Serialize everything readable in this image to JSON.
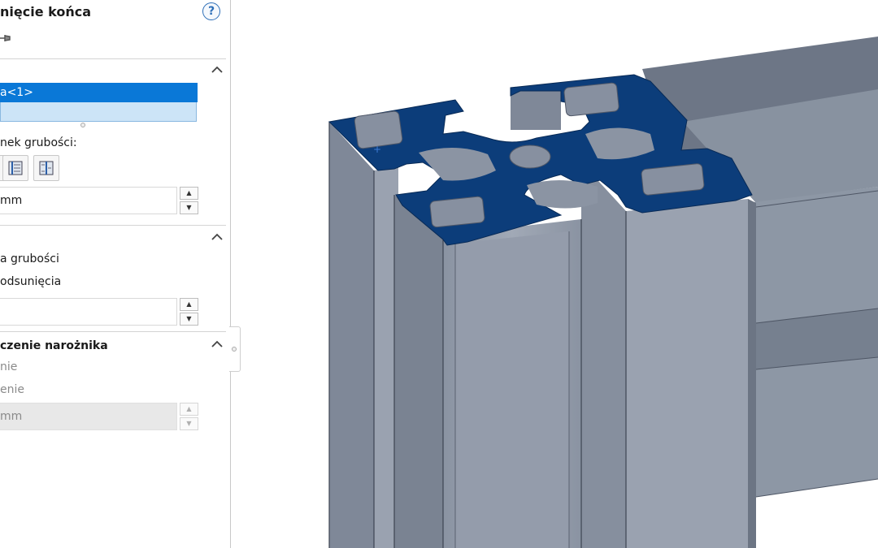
{
  "panel": {
    "title": "nięcie końca",
    "help_label": "?",
    "section_select": {
      "selected_item": "a<1>"
    },
    "section_thickness": {
      "direction_label": "nek grubości:",
      "thickness_value": "mm"
    },
    "section_offset": {
      "option1_label": "a grubości",
      "option2_label": "odsunięcia",
      "offset_value": ""
    },
    "section_corner": {
      "header": "czenie narożnika",
      "option1_label": "nie",
      "option2_label": "enie",
      "value": "mm"
    }
  },
  "viewport": {
    "colors": {
      "face_selected": "#0c3d7a",
      "metal_light": "#9aa2b0",
      "metal_mid": "#8a93a2",
      "metal_dark": "#5b6473"
    }
  }
}
